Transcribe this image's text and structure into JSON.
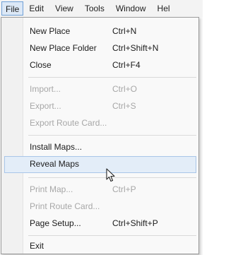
{
  "menubar": {
    "items": [
      {
        "label": "File"
      },
      {
        "label": "Edit"
      },
      {
        "label": "View"
      },
      {
        "label": "Tools"
      },
      {
        "label": "Window"
      },
      {
        "label": "Hel"
      }
    ]
  },
  "file_menu": {
    "new_place": {
      "label": "New Place",
      "shortcut": "Ctrl+N"
    },
    "new_place_folder": {
      "label": "New Place Folder",
      "shortcut": "Ctrl+Shift+N"
    },
    "close": {
      "label": "Close",
      "shortcut": "Ctrl+F4"
    },
    "import": {
      "label": "Import...",
      "shortcut": "Ctrl+O"
    },
    "export": {
      "label": "Export...",
      "shortcut": "Ctrl+S"
    },
    "export_route_card": {
      "label": "Export Route Card..."
    },
    "install_maps": {
      "label": "Install Maps..."
    },
    "reveal_maps": {
      "label": "Reveal Maps"
    },
    "print_map": {
      "label": "Print Map...",
      "shortcut": "Ctrl+P"
    },
    "print_route_card": {
      "label": "Print Route Card..."
    },
    "page_setup": {
      "label": "Page Setup...",
      "shortcut": "Ctrl+Shift+P"
    },
    "exit": {
      "label": "Exit"
    }
  },
  "colors": {
    "highlight_bg": "#e3edf8",
    "highlight_border": "#a9c6e8",
    "disabled_text": "#a7a7a7"
  }
}
